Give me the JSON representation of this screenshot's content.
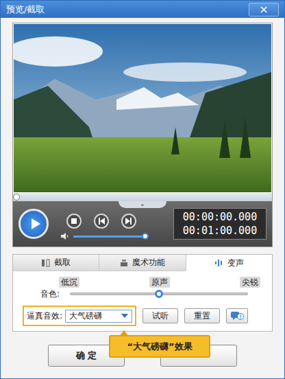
{
  "window": {
    "title": "预览/截取",
    "close": "×"
  },
  "player": {
    "seek_level": 0,
    "toggle": "⌄",
    "volume_level": 0.97,
    "time_current": "00:00:00.000",
    "time_total": "00:01:00.000"
  },
  "tabs": [
    {
      "label": "截取",
      "selected": false
    },
    {
      "label": "魔术功能",
      "selected": false
    },
    {
      "label": "变声",
      "selected": true
    }
  ],
  "voice": {
    "marks": [
      "低沉",
      "原声",
      "尖锐"
    ],
    "label": "音色:",
    "level": 0.5
  },
  "effect": {
    "label": "逼真音效:",
    "value": "大气磅礴",
    "highlighted": true
  },
  "actions": [
    "试听",
    "重置"
  ],
  "tooltip": "“大气磅礴”效果",
  "footer": {
    "buttons": [
      {
        "label": "确 定"
      },
      {
        "label": ""
      }
    ]
  }
}
